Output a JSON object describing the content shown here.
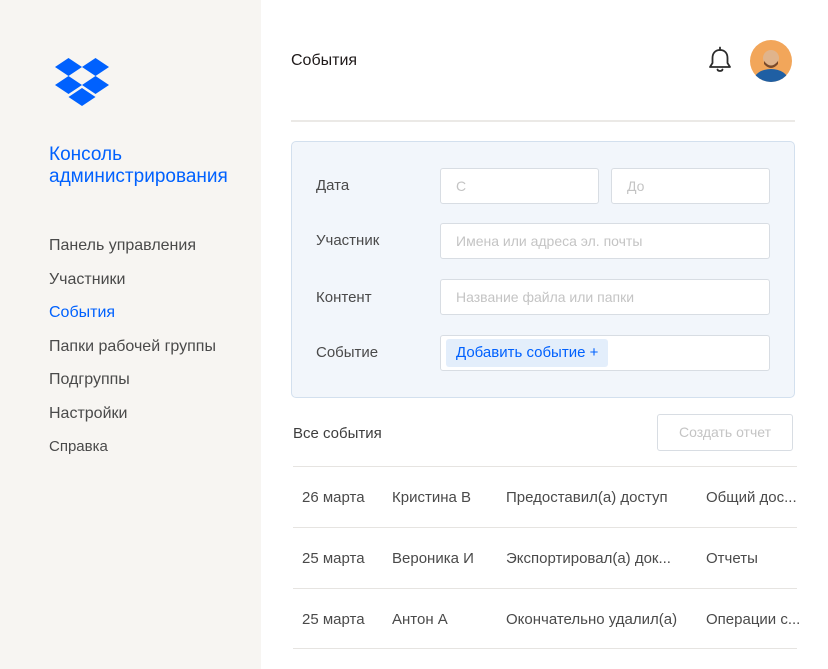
{
  "sidebar": {
    "logo": "dropbox-logo",
    "console_title": "Консоль администрирования",
    "nav": [
      {
        "label": "Панель управления",
        "active": false
      },
      {
        "label": "Участники",
        "active": false
      },
      {
        "label": "События",
        "active": true
      },
      {
        "label": "Папки рабочей группы",
        "active": false
      },
      {
        "label": "Подгруппы",
        "active": false
      },
      {
        "label": "Настройки",
        "active": false
      },
      {
        "label": "Справка",
        "active": false
      }
    ]
  },
  "header": {
    "title": "События",
    "bell_icon": "bell-icon",
    "avatar": "user-avatar"
  },
  "filters": {
    "date_label": "Дата",
    "date_from_placeholder": "С",
    "date_to_placeholder": "До",
    "member_label": "Участник",
    "member_placeholder": "Имена или адреса эл. почты",
    "content_label": "Контент",
    "content_placeholder": "Название файла или папки",
    "event_label": "Событие",
    "add_event_label": "Добавить событие +"
  },
  "events": {
    "heading": "Все события",
    "report_button": "Создать отчет",
    "rows": [
      {
        "date": "26 марта",
        "user": "Кристина В",
        "action": "Предоставил(а) доступ",
        "category": "Общий дос..."
      },
      {
        "date": "25 марта",
        "user": "Вероника И",
        "action": "Экспортировал(а) док...",
        "category": "Отчеты"
      },
      {
        "date": "25 марта",
        "user": "Антон А",
        "action": "Окончательно удалил(а)",
        "category": "Операции с..."
      }
    ]
  },
  "colors": {
    "accent": "#0061fe",
    "sidebar_bg": "#f7f5f2",
    "filter_bg": "#f2f6fb"
  }
}
